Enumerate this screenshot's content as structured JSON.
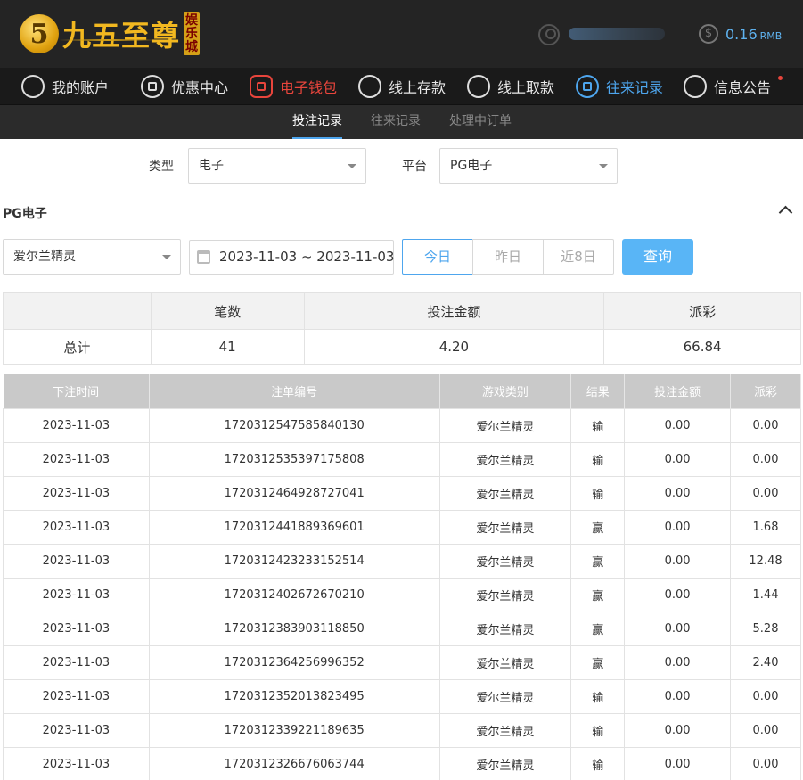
{
  "header": {
    "logo_mark": "5",
    "logo_text": "九五至尊",
    "logo_badge": [
      "娱",
      "乐",
      "城"
    ],
    "balance": "0.16",
    "balance_unit": "RMB"
  },
  "nav": {
    "items": [
      {
        "label": "我的账户"
      },
      {
        "label": "优惠中心"
      },
      {
        "label": "电子钱包"
      },
      {
        "label": "线上存款"
      },
      {
        "label": "线上取款"
      },
      {
        "label": "往来记录"
      },
      {
        "label": "信息公告"
      }
    ]
  },
  "subnav": {
    "tabs": [
      {
        "label": "投注记录"
      },
      {
        "label": "往来记录"
      },
      {
        "label": "处理中订单"
      }
    ]
  },
  "filters": {
    "type_label": "类型",
    "type_value": "电子",
    "platform_label": "平台",
    "platform_value": "PG电子"
  },
  "section": {
    "title": "PG电子",
    "game_value": "爱尔兰精灵",
    "date_range": "2023-11-03 ~ 2023-11-03",
    "quick_ranges": [
      "今日",
      "昨日",
      "近8日"
    ],
    "query_label": "查询"
  },
  "summary": {
    "headers": [
      "",
      "笔数",
      "投注金额",
      "派彩"
    ],
    "row": [
      "总计",
      "41",
      "4.20",
      "66.84"
    ]
  },
  "records": {
    "headers": [
      "下注时间",
      "注单编号",
      "游戏类别",
      "结果",
      "投注金额",
      "派彩"
    ],
    "rows": [
      [
        "2023-11-03",
        "1720312547585840130",
        "爱尔兰精灵",
        "输",
        "0.00",
        "0.00"
      ],
      [
        "2023-11-03",
        "1720312535397175808",
        "爱尔兰精灵",
        "输",
        "0.00",
        "0.00"
      ],
      [
        "2023-11-03",
        "1720312464928727041",
        "爱尔兰精灵",
        "输",
        "0.00",
        "0.00"
      ],
      [
        "2023-11-03",
        "1720312441889369601",
        "爱尔兰精灵",
        "赢",
        "0.00",
        "1.68"
      ],
      [
        "2023-11-03",
        "1720312423233152514",
        "爱尔兰精灵",
        "赢",
        "0.00",
        "12.48"
      ],
      [
        "2023-11-03",
        "1720312402672670210",
        "爱尔兰精灵",
        "赢",
        "0.00",
        "1.44"
      ],
      [
        "2023-11-03",
        "1720312383903118850",
        "爱尔兰精灵",
        "赢",
        "0.00",
        "5.28"
      ],
      [
        "2023-11-03",
        "1720312364256996352",
        "爱尔兰精灵",
        "赢",
        "0.00",
        "2.40"
      ],
      [
        "2023-11-03",
        "1720312352013823495",
        "爱尔兰精灵",
        "输",
        "0.00",
        "0.00"
      ],
      [
        "2023-11-03",
        "1720312339221189635",
        "爱尔兰精灵",
        "输",
        "0.00",
        "0.00"
      ],
      [
        "2023-11-03",
        "1720312326676063744",
        "爱尔兰精灵",
        "输",
        "0.00",
        "0.00"
      ]
    ]
  },
  "colors": {
    "accent_blue": "#4ea6ee",
    "accent_red": "#e8453c",
    "logo_gold": "#f2b820",
    "header_bg": "#242424"
  }
}
